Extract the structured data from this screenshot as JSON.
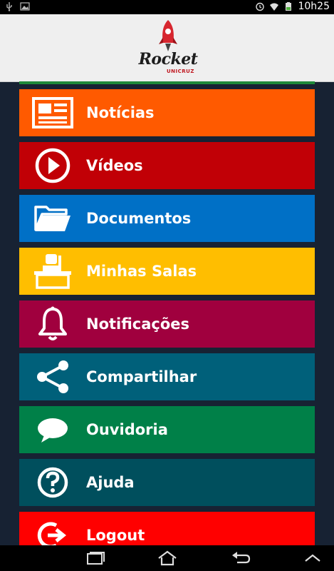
{
  "status_bar": {
    "time": "10h25",
    "icons": [
      "usb-icon",
      "image-icon",
      "alarm-icon",
      "wifi-icon",
      "battery-icon"
    ]
  },
  "header": {
    "logo_text": "Rocket",
    "logo_subtext": "UNICRUZ",
    "logo_icon": "rocket-icon"
  },
  "menu": {
    "items": [
      {
        "label": "Notícias",
        "icon": "newspaper-icon",
        "color": "#ff5a00"
      },
      {
        "label": "Vídeos",
        "icon": "play-icon",
        "color": "#c10006"
      },
      {
        "label": "Documentos",
        "icon": "folder-icon",
        "color": "#0070c6"
      },
      {
        "label": "Minhas Salas",
        "icon": "classroom-icon",
        "color": "#ffbe00"
      },
      {
        "label": "Notificações",
        "icon": "bell-icon",
        "color": "#a0003e"
      },
      {
        "label": "Compartilhar",
        "icon": "share-icon",
        "color": "#00607a"
      },
      {
        "label": "Ouvidoria",
        "icon": "chat-icon",
        "color": "#008048"
      },
      {
        "label": "Ajuda",
        "icon": "help-icon",
        "color": "#004f5d"
      },
      {
        "label": "Logout",
        "icon": "logout-icon",
        "color": "#ff0000"
      }
    ]
  },
  "nav_bar": {
    "buttons": [
      "recent-apps-icon",
      "home-icon",
      "back-icon",
      "menu-up-icon"
    ]
  }
}
